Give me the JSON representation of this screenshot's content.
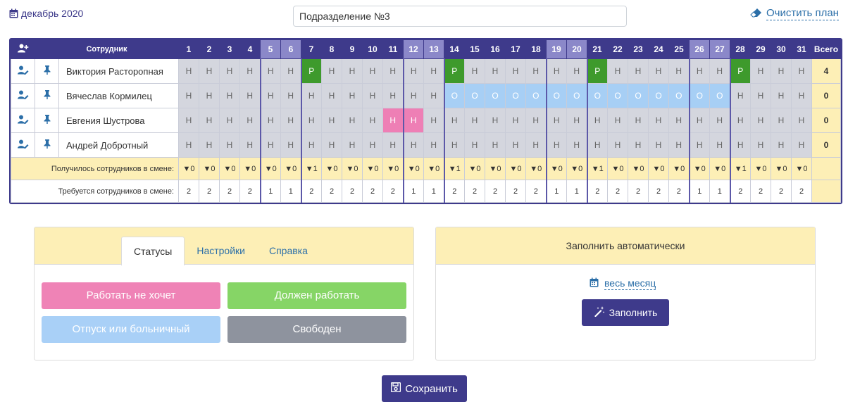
{
  "header": {
    "month_label": "декабрь 2020",
    "department_value": "Подразделение №3",
    "clear_plan_label": "Очистить план"
  },
  "colors": {
    "primary": "#3e3a8b",
    "weekend_header": "#8b88c9",
    "status_free": "#d4d6de",
    "status_work": "#3e9a2c",
    "status_vacation": "#a7cff5",
    "status_not_want": "#ee7fb5",
    "summary_bg": "#fdefb6"
  },
  "schedule": {
    "employee_header": "Сотрудник",
    "total_header": "Всего",
    "days": [
      "1",
      "2",
      "3",
      "4",
      "5",
      "6",
      "7",
      "8",
      "9",
      "10",
      "11",
      "12",
      "13",
      "14",
      "15",
      "16",
      "17",
      "18",
      "19",
      "20",
      "21",
      "22",
      "23",
      "24",
      "25",
      "26",
      "27",
      "28",
      "29",
      "30",
      "31"
    ],
    "weekend_days": [
      5,
      6,
      12,
      13,
      19,
      20,
      26,
      27
    ],
    "employees": [
      {
        "name": "Виктория Расторопная",
        "total": "4",
        "cells": [
          "Н",
          "Н",
          "Н",
          "Н",
          "Н",
          "Н",
          "Р",
          "Н",
          "Н",
          "Н",
          "Н",
          "Н",
          "Н",
          "Р",
          "Н",
          "Н",
          "Н",
          "Н",
          "Н",
          "Н",
          "Р",
          "Н",
          "Н",
          "Н",
          "Н",
          "Н",
          "Н",
          "Р",
          "Н",
          "Н",
          "Н"
        ]
      },
      {
        "name": "Вячеслав Кормилец",
        "total": "0",
        "cells": [
          "Н",
          "Н",
          "Н",
          "Н",
          "Н",
          "Н",
          "Н",
          "Н",
          "Н",
          "Н",
          "Н",
          "Н",
          "Н",
          "О",
          "О",
          "О",
          "О",
          "О",
          "О",
          "О",
          "О",
          "О",
          "О",
          "О",
          "О",
          "О",
          "О",
          "Н",
          "Н",
          "Н",
          "Н"
        ]
      },
      {
        "name": "Евгения Шустрова",
        "total": "0",
        "cells": [
          "Н",
          "Н",
          "Н",
          "Н",
          "Н",
          "Н",
          "Н",
          "Н",
          "Н",
          "Н",
          "Н",
          "Н",
          "Н",
          "Н",
          "Н",
          "Н",
          "Н",
          "Н",
          "Н",
          "Н",
          "Н",
          "Н",
          "Н",
          "Н",
          "Н",
          "Н",
          "Н",
          "Н",
          "Н",
          "Н",
          "Н"
        ],
        "pink_days": [
          11,
          12
        ]
      },
      {
        "name": "Андрей Добротный",
        "total": "0",
        "cells": [
          "Н",
          "Н",
          "Н",
          "Н",
          "Н",
          "Н",
          "Н",
          "Н",
          "Н",
          "Н",
          "Н",
          "Н",
          "Н",
          "Н",
          "Н",
          "Н",
          "Н",
          "Н",
          "Н",
          "Н",
          "Н",
          "Н",
          "Н",
          "Н",
          "Н",
          "Н",
          "Н",
          "Н",
          "Н",
          "Н",
          "Н"
        ]
      }
    ],
    "got_label": "Получилось сотрудников в смене:",
    "got_values": [
      "0",
      "0",
      "0",
      "0",
      "0",
      "0",
      "1",
      "0",
      "0",
      "0",
      "0",
      "0",
      "0",
      "1",
      "0",
      "0",
      "0",
      "0",
      "0",
      "0",
      "1",
      "0",
      "0",
      "0",
      "0",
      "0",
      "0",
      "1",
      "0",
      "0",
      "0"
    ],
    "required_label": "Требуется сотрудников в смене:",
    "required_values": [
      "2",
      "2",
      "2",
      "2",
      "1",
      "1",
      "2",
      "2",
      "2",
      "2",
      "2",
      "1",
      "1",
      "2",
      "2",
      "2",
      "2",
      "2",
      "1",
      "1",
      "2",
      "2",
      "2",
      "2",
      "2",
      "1",
      "1",
      "2",
      "2",
      "2",
      "2"
    ]
  },
  "status_panel": {
    "tabs": [
      "Статусы",
      "Настройки",
      "Справка"
    ],
    "active_tab": "Статусы",
    "buttons": {
      "not_want": "Работать не хочет",
      "must_work": "Должен работать",
      "vacation": "Отпуск или больничный",
      "free": "Свободен"
    }
  },
  "auto_fill": {
    "title": "Заполнить автоматически",
    "period_label": "весь месяц",
    "fill_label": "Заполнить"
  },
  "save_label": "Сохранить",
  "icons": [
    "calendar-icon",
    "eraser-icon",
    "add-user-icon",
    "edit-user-icon",
    "pin-icon",
    "magic-wand-icon",
    "floppy-disk-icon"
  ]
}
